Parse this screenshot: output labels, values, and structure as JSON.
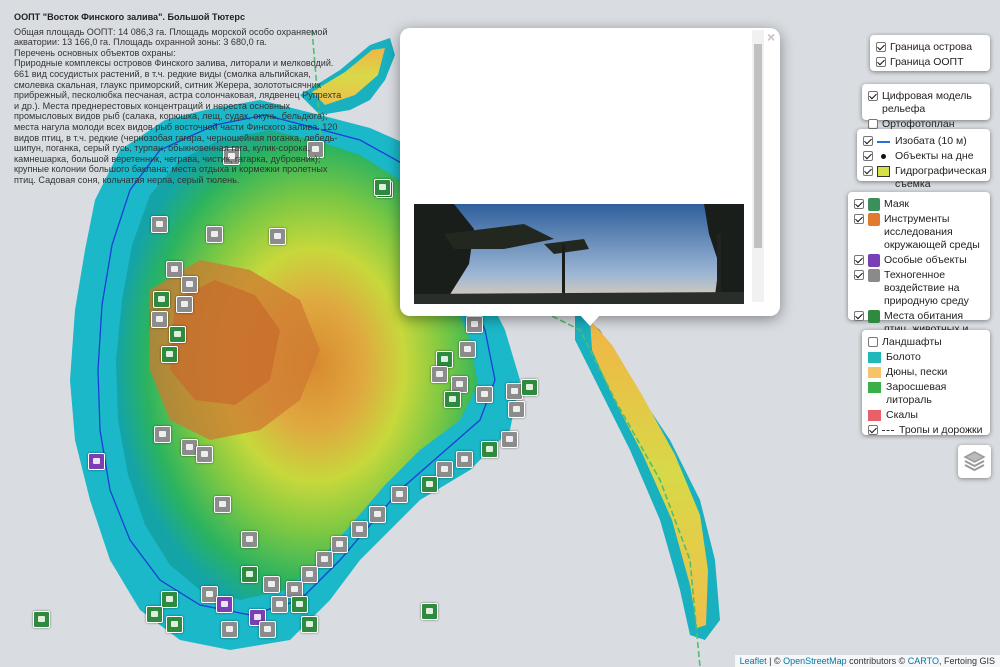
{
  "popup": {
    "title": "ООПТ \"Восток Финского залива\". Большой Тютерс",
    "area_line": "Общая площадь ООПТ: 14 086,3 га. Площадь морской особо охраняемой акватории: 13 166,0 га. Площадь охранной зоны: 3 680,0 га.",
    "objects_heading": "Перечень основных объектов охраны:",
    "objects_body": "Природные комплексы островов Финского залива, литорали и мелководий. 661 вид сосудистых растений, в т.ч. редкие виды (смолка альпийская, смолевка скальная, глаукс приморский, ситник Жерера, золототысячник прибрежный, песколюбка песчаная, астра солончаковая, лядвенец Рупрехта и др.). Места преднерестовых концентраций и нереста основных промысловых видов рыб (салака, корюшка, лещ, судак, окунь, бельдюга); места нагула молоди всех видов рыб восточной части Финского залива. 120 видов птиц, в т.ч. редкие (чернозобая гагара, черношейная поганка, лебедь-шипун, поганка, серый гусь, турпан, обыкновенная гага, кулик-сорока, камнешарка, большой веретенник, чеграва, чистик, гагарка, дубровник); крупные колонии большого баклана; места отдыха и кормежки пролетных птиц. Садовая соня, кольчатая нерпа, серый тюлень.",
    "close_symbol": "×"
  },
  "panel_borders": [
    {
      "label": "Граница острова",
      "checked": true
    },
    {
      "label": "Граница ООПТ",
      "checked": true
    }
  ],
  "panel_base": [
    {
      "label": "Цифровая модель рельефа",
      "checked": true
    },
    {
      "label": "Ортофотоплан",
      "checked": false
    }
  ],
  "panel_survey": [
    {
      "label": "Изобата (10 м)",
      "checked": true
    },
    {
      "label": "Объекты на дне",
      "checked": true
    },
    {
      "label": "Гидрографическая съемка",
      "checked": true
    }
  ],
  "panel_poi": [
    {
      "label": "Маяк",
      "checked": true,
      "color": "#3a8f5a"
    },
    {
      "label": "Инструменты исследования окружающей среды",
      "checked": true,
      "color": "#e07a2e"
    },
    {
      "label": "Особые объекты",
      "checked": true,
      "color": "#7b3fb5"
    },
    {
      "label": "Техногенное воздействие на природную среду",
      "checked": true,
      "color": "#8a8a8a"
    },
    {
      "label": "Места обитания птиц, животных и расстений",
      "checked": true,
      "color": "#2e8b3e"
    }
  ],
  "panel_landscape": [
    {
      "label": "Ландшафты",
      "type": "checkbox",
      "checked": false
    },
    {
      "label": "Болото",
      "type": "swatch",
      "color": "#20b8b8"
    },
    {
      "label": "Дюны, пески",
      "type": "swatch",
      "color": "#f5c36a"
    },
    {
      "label": "Заросшевая литораль",
      "type": "swatch",
      "color": "#3aae48"
    },
    {
      "label": "Скалы",
      "type": "swatch",
      "color": "#e8606a"
    },
    {
      "label": "Тропы и дорожки",
      "type": "dashed",
      "checked": true
    }
  ],
  "attribution": {
    "leaflet": "Leaflet",
    "sep1": " | © ",
    "osm": "OpenStreetMap",
    "contrib": " contributors © ",
    "carto": "CARTO",
    "extra": ", Fertoing GIS"
  }
}
